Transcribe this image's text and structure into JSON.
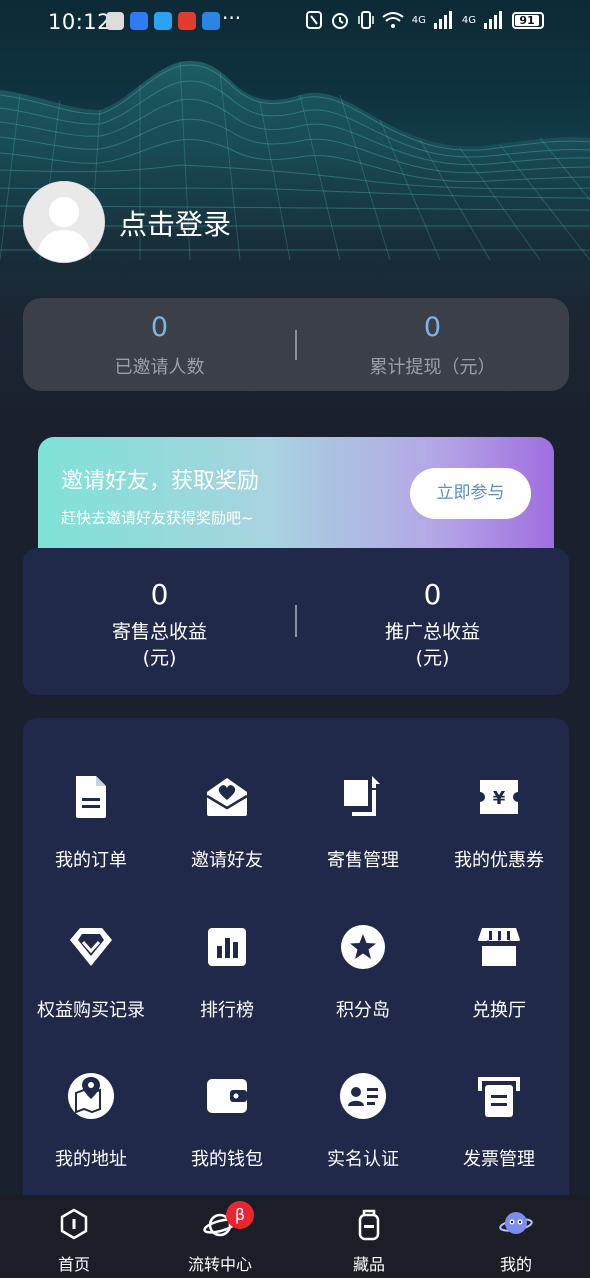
{
  "status_bar": {
    "time": "10:12",
    "more": "···",
    "battery": "91",
    "network_a": "4G",
    "network_b": "4G"
  },
  "profile": {
    "login_text": "点击登录"
  },
  "stats": {
    "invited_count": "0",
    "invited_label": "已邀请人数",
    "withdrawn_total": "0",
    "withdrawn_label": "累计提现（元）"
  },
  "invite_banner": {
    "title": "邀请好友，获取奖励",
    "subtitle": "赶快去邀请好友获得奖励吧~",
    "button": "立即参与"
  },
  "earnings": {
    "consign_value": "0",
    "consign_label_line1": "寄售总收益",
    "consign_label_line2": "(元)",
    "promo_value": "0",
    "promo_label_line1": "推广总收益",
    "promo_label_line2": "(元)"
  },
  "menu": {
    "items": [
      {
        "label": "我的订单",
        "icon": "document-icon"
      },
      {
        "label": "邀请好友",
        "icon": "envelope-heart-icon"
      },
      {
        "label": "寄售管理",
        "icon": "transfer-icon"
      },
      {
        "label": "我的优惠券",
        "icon": "coupon-icon"
      },
      {
        "label": "权益购买记录",
        "icon": "diamond-icon"
      },
      {
        "label": "排行榜",
        "icon": "bar-chart-icon"
      },
      {
        "label": "积分岛",
        "icon": "star-icon"
      },
      {
        "label": "兑换厅",
        "icon": "shop-icon"
      },
      {
        "label": "我的地址",
        "icon": "map-pin-icon"
      },
      {
        "label": "我的钱包",
        "icon": "wallet-icon"
      },
      {
        "label": "实名认证",
        "icon": "id-card-icon"
      },
      {
        "label": "发票管理",
        "icon": "invoice-icon"
      }
    ]
  },
  "tabbar": {
    "home": "首页",
    "circulation": "流转中心",
    "circulation_badge": "β",
    "collection": "藏品",
    "mine": "我的"
  },
  "colors": {
    "background": "#1b202e",
    "card": "#20294a",
    "stats_card": "#3a3f48",
    "accent_blue": "#7fb4e6",
    "badge_red": "#e8262f"
  }
}
